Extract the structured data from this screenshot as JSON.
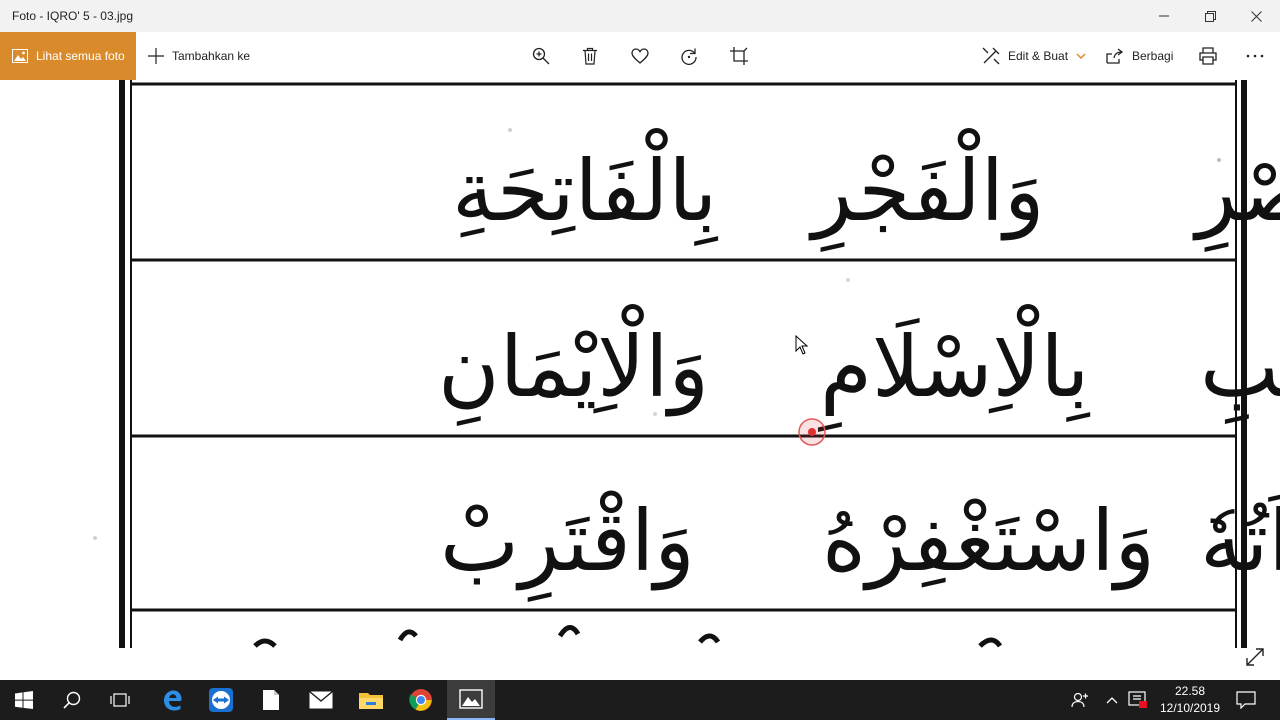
{
  "window": {
    "title": "Foto - IQRO' 5 - 03.jpg",
    "minimize_icon": "minimize-icon",
    "maximize_icon": "restore-icon",
    "close_icon": "close-icon"
  },
  "toolbar": {
    "see_all_label": "Lihat semua foto",
    "add_to_label": "Tambahkan ke",
    "edit_create_label": "Edit & Buat",
    "share_label": "Berbagi",
    "icons": [
      "zoom-icon",
      "trash-icon",
      "heart-icon",
      "rotate-icon",
      "crop-icon",
      "print-icon",
      "more-icon"
    ],
    "accent": "#d98b2b"
  },
  "scan": {
    "rows": [
      [
        "وَالْعَصْرِ",
        "وَالْفَجْرِ",
        "بِالْفَاتِحَةِ"
      ],
      [
        "فِى الْكِتٰبِ",
        "بِالْاِسْلَامِ",
        "وَالْاِيْمَانِ"
      ],
      [
        "وَامْرَاَتُهٗ",
        "وَاسْتَغْفِرْهُ",
        "وَاقْتَرِبْ"
      ]
    ]
  },
  "taskbar": {
    "apps": [
      "windows-start-icon",
      "search-icon",
      "task-view-icon",
      "edge-icon",
      "teamviewer-icon",
      "file-icon",
      "mail-icon",
      "file-explorer-icon",
      "chrome-icon",
      "photos-icon"
    ],
    "time": "22.58",
    "date": "12/10/2019"
  }
}
